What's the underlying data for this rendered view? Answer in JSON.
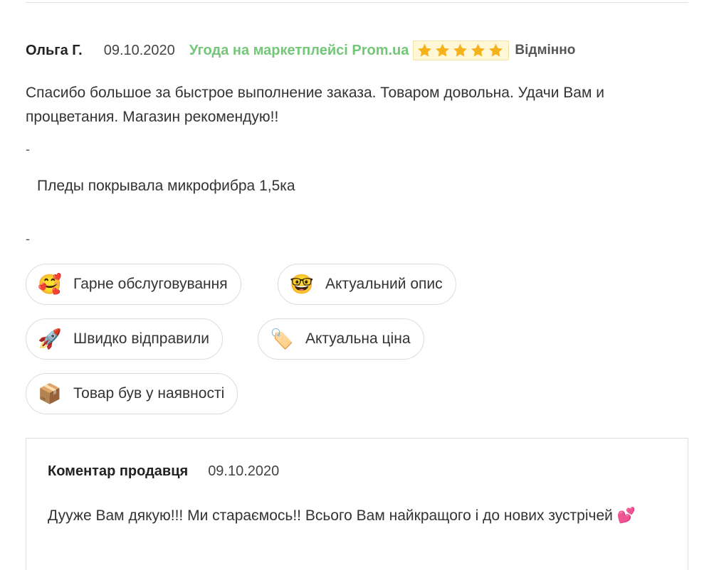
{
  "review": {
    "author": "Ольга Г.",
    "date": "09.10.2020",
    "deal_label": "Угода на маркетплейсі Prom.ua",
    "rating": 5,
    "rating_max": 5,
    "rating_label": "Відмінно",
    "text": "Спасибо большое за быстрое выполнение заказа. Товаром довольна. Удачи Вам и процветания. Магазин рекомендую!!",
    "separator": "-",
    "product": "Пледы покрывала микрофибра 1,5ка"
  },
  "tags": [
    {
      "emoji": "🥰",
      "icon": "smiling-face-with-hearts-icon",
      "label": "Гарне обслуговування"
    },
    {
      "emoji": "🤓",
      "icon": "nerd-face-icon",
      "label": "Актуальний опис"
    },
    {
      "emoji": "🚀",
      "icon": "rocket-icon",
      "label": "Швидко відправили"
    },
    {
      "emoji": "🏷️",
      "icon": "price-tag-icon",
      "label": "Актуальна ціна"
    },
    {
      "emoji": "📦",
      "icon": "package-icon",
      "label": "Товар був у наявності"
    }
  ],
  "seller_comment": {
    "title": "Коментар продавця",
    "date": "09.10.2020",
    "text": "Дууже Вам дякую!!! Ми стараємось!! Всього Вам найкращого і до нових зустрічей 💕"
  },
  "colors": {
    "deal_green": "#73c777",
    "star_gold": "#f6b21b",
    "border": "#dcdcdc"
  }
}
